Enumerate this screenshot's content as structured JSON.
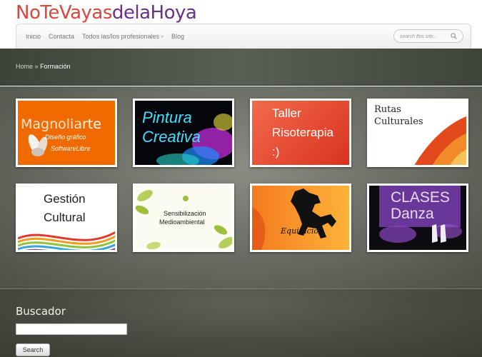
{
  "site": {
    "logo_part1": "NoTeVayas",
    "logo_part2": "delaHoya"
  },
  "nav": {
    "items": [
      {
        "label": "Inicio"
      },
      {
        "label": "Contacta"
      },
      {
        "label": "Todos las/los profesionales",
        "has_dropdown": true,
        "dropdown_icon": "chevron-down-icon"
      },
      {
        "label": "Blog"
      }
    ],
    "search_placeholder": "search this site...",
    "search_icon": "search-icon"
  },
  "breadcrumb": {
    "home": "Home",
    "separator": "»",
    "current": "Formación"
  },
  "tiles": [
    {
      "lines": [
        "Magnolia",
        "rte"
      ],
      "sub": [
        "Diseño gráfico",
        "SoftwareLibre"
      ],
      "bg": "#f06a00"
    },
    {
      "lines": [
        "Pintura",
        "Creativa"
      ],
      "bg": "#05060c"
    },
    {
      "lines": [
        "Taller",
        "Risoterapia",
        ":)"
      ],
      "bg": "#e24a30"
    },
    {
      "lines": [
        "Rutas",
        "Culturales"
      ],
      "bg": "#ffffff"
    },
    {
      "lines": [
        "Gestión",
        "Cultural"
      ],
      "bg": "#ffffff"
    },
    {
      "lines": [
        "Sensibilización",
        "Medioambiental"
      ],
      "bg": "#fbfbf2"
    },
    {
      "lines": [
        "Equitación"
      ],
      "bg": "#f47a1e"
    },
    {
      "lines": [
        "CLASES",
        "Danza"
      ],
      "bg": "#0d0b10"
    }
  ],
  "widget": {
    "title": "Buscador",
    "input_value": "",
    "button_label": "Search"
  },
  "colors": {
    "logo_red": "#d8473b",
    "logo_purple": "#6b2f8c",
    "band_dark": "#3e4338"
  }
}
